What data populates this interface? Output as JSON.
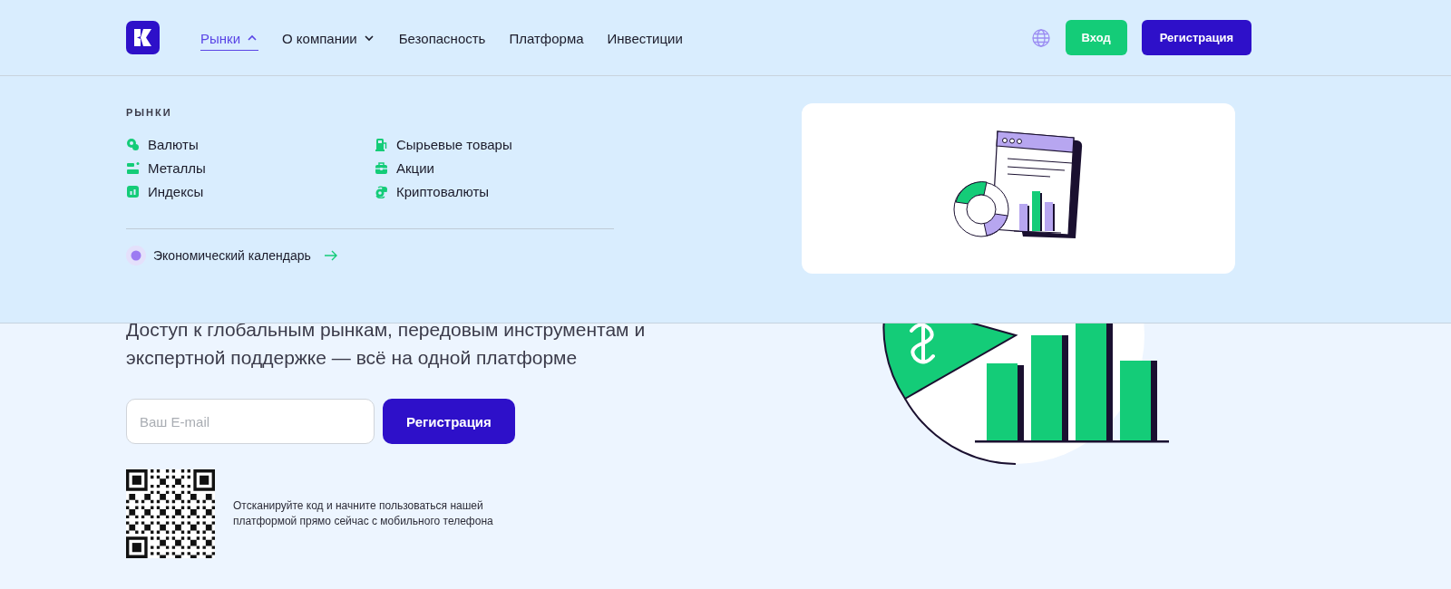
{
  "header": {
    "nav": [
      {
        "label": "Рынки",
        "kind": "dropdown",
        "selected": true,
        "expanded": true
      },
      {
        "label": "О компании",
        "kind": "dropdown",
        "selected": false,
        "expanded": false
      },
      {
        "label": "Безопасность",
        "kind": "link",
        "selected": false
      },
      {
        "label": "Платформа",
        "kind": "link",
        "selected": false
      },
      {
        "label": "Инвестиции",
        "kind": "link",
        "selected": false
      }
    ],
    "login": "Вход",
    "register": "Регистрация"
  },
  "dropdown": {
    "heading": "РЫНКИ",
    "items": [
      {
        "label": "Валюты"
      },
      {
        "label": "Сырьевые товары"
      },
      {
        "label": "Металлы"
      },
      {
        "label": "Акции"
      },
      {
        "label": "Индексы"
      },
      {
        "label": "Криптовалюты"
      }
    ],
    "calendar_link": "Экономический календарь"
  },
  "hero": {
    "subtitle": "Доступ к глобальным рынкам, передовым инструментам и экспертной поддержке — всё на одной платформе",
    "email_placeholder": "Ваш E-mail",
    "register": "Регистрация",
    "qr_caption": "Отсканируйте код и начните пользоваться нашей платформой прямо сейчас с мобильного телефона"
  }
}
